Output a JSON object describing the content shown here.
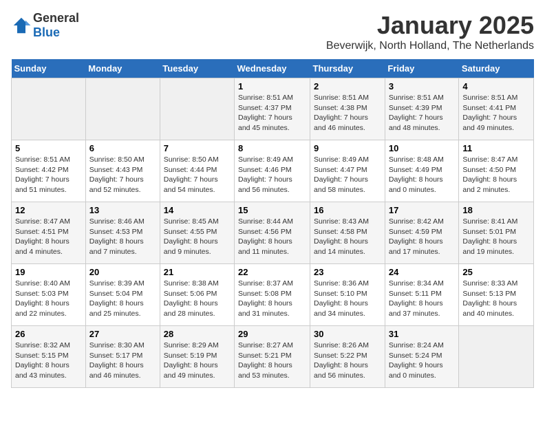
{
  "header": {
    "logo_general": "General",
    "logo_blue": "Blue",
    "month_year": "January 2025",
    "location": "Beverwijk, North Holland, The Netherlands"
  },
  "days_of_week": [
    "Sunday",
    "Monday",
    "Tuesday",
    "Wednesday",
    "Thursday",
    "Friday",
    "Saturday"
  ],
  "weeks": [
    [
      {
        "day": "",
        "info": ""
      },
      {
        "day": "",
        "info": ""
      },
      {
        "day": "",
        "info": ""
      },
      {
        "day": "1",
        "info": "Sunrise: 8:51 AM\nSunset: 4:37 PM\nDaylight: 7 hours\nand 45 minutes."
      },
      {
        "day": "2",
        "info": "Sunrise: 8:51 AM\nSunset: 4:38 PM\nDaylight: 7 hours\nand 46 minutes."
      },
      {
        "day": "3",
        "info": "Sunrise: 8:51 AM\nSunset: 4:39 PM\nDaylight: 7 hours\nand 48 minutes."
      },
      {
        "day": "4",
        "info": "Sunrise: 8:51 AM\nSunset: 4:41 PM\nDaylight: 7 hours\nand 49 minutes."
      }
    ],
    [
      {
        "day": "5",
        "info": "Sunrise: 8:51 AM\nSunset: 4:42 PM\nDaylight: 7 hours\nand 51 minutes."
      },
      {
        "day": "6",
        "info": "Sunrise: 8:50 AM\nSunset: 4:43 PM\nDaylight: 7 hours\nand 52 minutes."
      },
      {
        "day": "7",
        "info": "Sunrise: 8:50 AM\nSunset: 4:44 PM\nDaylight: 7 hours\nand 54 minutes."
      },
      {
        "day": "8",
        "info": "Sunrise: 8:49 AM\nSunset: 4:46 PM\nDaylight: 7 hours\nand 56 minutes."
      },
      {
        "day": "9",
        "info": "Sunrise: 8:49 AM\nSunset: 4:47 PM\nDaylight: 7 hours\nand 58 minutes."
      },
      {
        "day": "10",
        "info": "Sunrise: 8:48 AM\nSunset: 4:49 PM\nDaylight: 8 hours\nand 0 minutes."
      },
      {
        "day": "11",
        "info": "Sunrise: 8:47 AM\nSunset: 4:50 PM\nDaylight: 8 hours\nand 2 minutes."
      }
    ],
    [
      {
        "day": "12",
        "info": "Sunrise: 8:47 AM\nSunset: 4:51 PM\nDaylight: 8 hours\nand 4 minutes."
      },
      {
        "day": "13",
        "info": "Sunrise: 8:46 AM\nSunset: 4:53 PM\nDaylight: 8 hours\nand 7 minutes."
      },
      {
        "day": "14",
        "info": "Sunrise: 8:45 AM\nSunset: 4:55 PM\nDaylight: 8 hours\nand 9 minutes."
      },
      {
        "day": "15",
        "info": "Sunrise: 8:44 AM\nSunset: 4:56 PM\nDaylight: 8 hours\nand 11 minutes."
      },
      {
        "day": "16",
        "info": "Sunrise: 8:43 AM\nSunset: 4:58 PM\nDaylight: 8 hours\nand 14 minutes."
      },
      {
        "day": "17",
        "info": "Sunrise: 8:42 AM\nSunset: 4:59 PM\nDaylight: 8 hours\nand 17 minutes."
      },
      {
        "day": "18",
        "info": "Sunrise: 8:41 AM\nSunset: 5:01 PM\nDaylight: 8 hours\nand 19 minutes."
      }
    ],
    [
      {
        "day": "19",
        "info": "Sunrise: 8:40 AM\nSunset: 5:03 PM\nDaylight: 8 hours\nand 22 minutes."
      },
      {
        "day": "20",
        "info": "Sunrise: 8:39 AM\nSunset: 5:04 PM\nDaylight: 8 hours\nand 25 minutes."
      },
      {
        "day": "21",
        "info": "Sunrise: 8:38 AM\nSunset: 5:06 PM\nDaylight: 8 hours\nand 28 minutes."
      },
      {
        "day": "22",
        "info": "Sunrise: 8:37 AM\nSunset: 5:08 PM\nDaylight: 8 hours\nand 31 minutes."
      },
      {
        "day": "23",
        "info": "Sunrise: 8:36 AM\nSunset: 5:10 PM\nDaylight: 8 hours\nand 34 minutes."
      },
      {
        "day": "24",
        "info": "Sunrise: 8:34 AM\nSunset: 5:11 PM\nDaylight: 8 hours\nand 37 minutes."
      },
      {
        "day": "25",
        "info": "Sunrise: 8:33 AM\nSunset: 5:13 PM\nDaylight: 8 hours\nand 40 minutes."
      }
    ],
    [
      {
        "day": "26",
        "info": "Sunrise: 8:32 AM\nSunset: 5:15 PM\nDaylight: 8 hours\nand 43 minutes."
      },
      {
        "day": "27",
        "info": "Sunrise: 8:30 AM\nSunset: 5:17 PM\nDaylight: 8 hours\nand 46 minutes."
      },
      {
        "day": "28",
        "info": "Sunrise: 8:29 AM\nSunset: 5:19 PM\nDaylight: 8 hours\nand 49 minutes."
      },
      {
        "day": "29",
        "info": "Sunrise: 8:27 AM\nSunset: 5:21 PM\nDaylight: 8 hours\nand 53 minutes."
      },
      {
        "day": "30",
        "info": "Sunrise: 8:26 AM\nSunset: 5:22 PM\nDaylight: 8 hours\nand 56 minutes."
      },
      {
        "day": "31",
        "info": "Sunrise: 8:24 AM\nSunset: 5:24 PM\nDaylight: 9 hours\nand 0 minutes."
      },
      {
        "day": "",
        "info": ""
      }
    ]
  ]
}
